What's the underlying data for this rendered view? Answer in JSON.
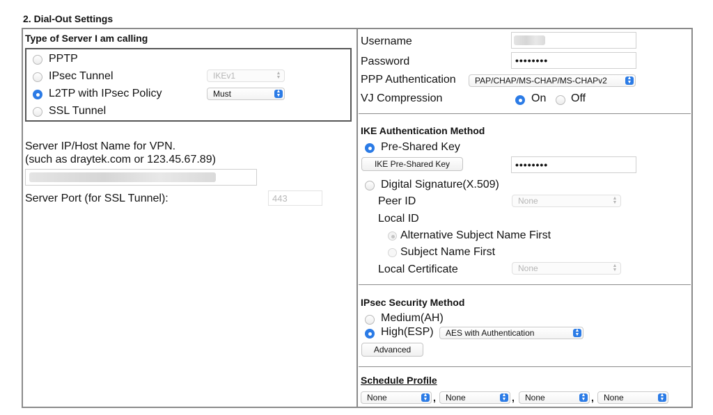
{
  "section_title": "2. Dial-Out Settings",
  "left": {
    "server_type": {
      "heading": "Type of Server I am calling",
      "options": [
        {
          "label": "PPTP",
          "selected": false
        },
        {
          "label": "IPsec Tunnel",
          "selected": false
        },
        {
          "label": "L2TP with IPsec Policy",
          "selected": true
        },
        {
          "label": "SSL Tunnel",
          "selected": false
        }
      ],
      "ipsec_tunnel_select": {
        "value": "IKEv1",
        "disabled": true
      },
      "l2tp_policy_select": {
        "value": "Must",
        "disabled": false
      }
    },
    "server_host": {
      "label_line1": "Server IP/Host Name for VPN.",
      "label_line2": "(such as draytek.com or 123.45.67.89)",
      "value": ""
    },
    "server_port": {
      "label": "Server Port (for SSL Tunnel):",
      "value": "443",
      "disabled": true
    }
  },
  "right": {
    "username": {
      "label": "Username",
      "value": ""
    },
    "password": {
      "label": "Password",
      "value": "••••••••"
    },
    "ppp_auth": {
      "label": "PPP Authentication",
      "value": "PAP/CHAP/MS-CHAP/MS-CHAPv2"
    },
    "vj_compression": {
      "label": "VJ Compression",
      "options": [
        {
          "label": "On",
          "selected": true
        },
        {
          "label": "Off",
          "selected": false
        }
      ]
    },
    "ike": {
      "heading": "IKE Authentication Method",
      "pre_shared": {
        "label": "Pre-Shared Key",
        "selected": true
      },
      "ike_psk_button": "IKE Pre-Shared Key",
      "ike_psk_value": "••••••••",
      "digital_signature": {
        "label": "Digital Signature(X.509)",
        "selected": false
      },
      "peer_id": {
        "label": "Peer ID",
        "value": "None"
      },
      "local_id": {
        "label": "Local ID",
        "options": [
          {
            "label": "Alternative Subject Name First",
            "selected": true
          },
          {
            "label": "Subject Name First",
            "selected": false
          }
        ]
      },
      "local_certificate": {
        "label": "Local Certificate",
        "value": "None"
      }
    },
    "ipsec": {
      "heading": "IPsec Security Method",
      "medium": {
        "label": "Medium(AH)",
        "selected": false
      },
      "high": {
        "label": "High(ESP)",
        "selected": true
      },
      "esp_select": "AES with Authentication",
      "advanced_button": "Advanced"
    },
    "schedule": {
      "heading": "Schedule Profile",
      "profiles": [
        "None",
        "None",
        "None",
        "None"
      ],
      "separator": ","
    }
  },
  "colors": {
    "accent": "#2b7be6",
    "border": "#8a8a8a"
  }
}
